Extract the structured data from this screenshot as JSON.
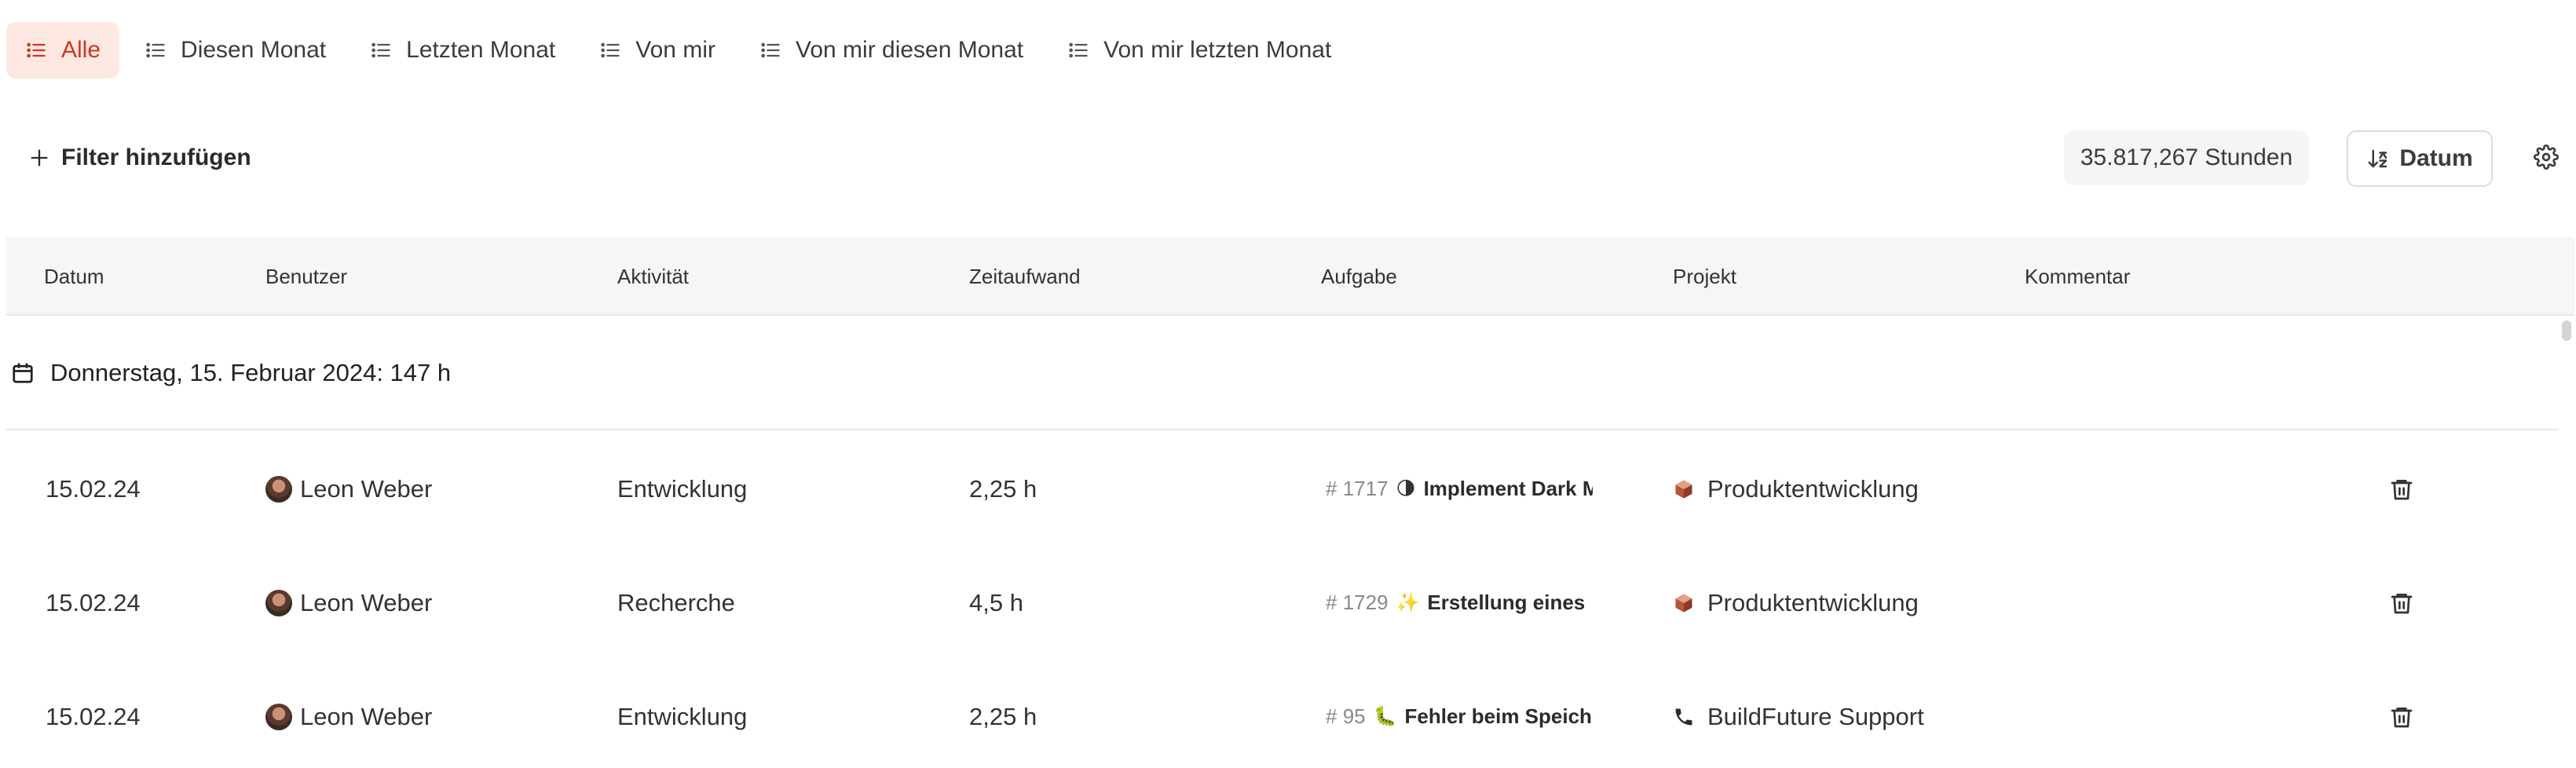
{
  "tabs": [
    {
      "label": "Alle",
      "active": true
    },
    {
      "label": "Diesen Monat",
      "active": false
    },
    {
      "label": "Letzten Monat",
      "active": false
    },
    {
      "label": "Von mir",
      "active": false
    },
    {
      "label": "Von mir diesen Monat",
      "active": false
    },
    {
      "label": "Von mir letzten Monat",
      "active": false
    }
  ],
  "toolbar": {
    "filter_label": "Filter hinzufügen",
    "total": "35.817,267 Stunden",
    "sort_label": "Datum"
  },
  "table": {
    "headers": [
      "Datum",
      "Benutzer",
      "Aktivität",
      "Zeitaufwand",
      "Aufgabe",
      "Projekt",
      "Kommentar"
    ],
    "group_label": "Donnerstag, 15. Februar 2024: 147 h",
    "rows": [
      {
        "date": "15.02.24",
        "user": "Leon Weber",
        "activity": "Entwicklung",
        "time": "2,25 h",
        "task_num": "1717",
        "task_emoji": "🌗",
        "task_title": "Implement Dark Mode",
        "project_icon": "cube-icon",
        "project": "Produktentwicklung",
        "comment": ""
      },
      {
        "date": "15.02.24",
        "user": "Leon Weber",
        "activity": "Recherche",
        "time": "4,5 h",
        "task_num": "1729",
        "task_emoji": "✨",
        "task_title": "Erstellung eines",
        "project_icon": "cube-icon",
        "project": "Produktentwicklung",
        "comment": ""
      },
      {
        "date": "15.02.24",
        "user": "Leon Weber",
        "activity": "Entwicklung",
        "time": "2,25 h",
        "task_num": "95",
        "task_emoji": "🐛",
        "task_title": "Fehler beim Speichern",
        "project_icon": "phone-icon",
        "project": "BuildFuture Support",
        "comment": ""
      }
    ]
  },
  "colors": {
    "accent": "#d0361f",
    "accent_bg": "#fde8e2",
    "header_bg": "#f6f6f6"
  }
}
